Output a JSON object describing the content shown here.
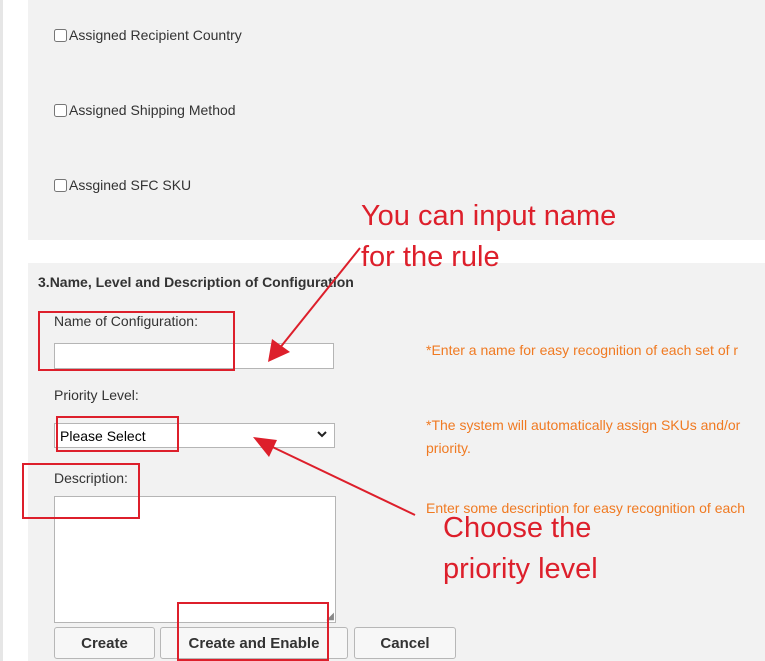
{
  "checkboxes": [
    {
      "label": "Assigned Recipient Country",
      "checked": false
    },
    {
      "label": "Assigned Shipping Method",
      "checked": false
    },
    {
      "label": "Assgined SFC SKU",
      "checked": false
    }
  ],
  "section": {
    "number": "3.",
    "title": "Name, Level and Description of Configuration"
  },
  "fields": {
    "name_label": "Name of Configuration:",
    "name_value": "",
    "priority_label": "Priority Level:",
    "priority_selected": "Please Select",
    "description_label": "Description:",
    "description_value": ""
  },
  "hints": {
    "name": "*Enter a name for easy recognition of each set of r",
    "priority_line1": "*The system will automatically assign SKUs and/or",
    "priority_line2": "priority.",
    "description": "Enter some description for easy recognition of each"
  },
  "buttons": {
    "create": "Create",
    "create_enable": "Create and Enable",
    "cancel": "Cancel"
  },
  "annotations": {
    "name_line1": "You can input name",
    "name_line2": "for the rule",
    "priority_line1": "Choose the",
    "priority_line2": "priority level"
  },
  "colors": {
    "annotation": "#dd1f2b",
    "hint": "#f07a22",
    "panel": "#f2f2f2"
  }
}
